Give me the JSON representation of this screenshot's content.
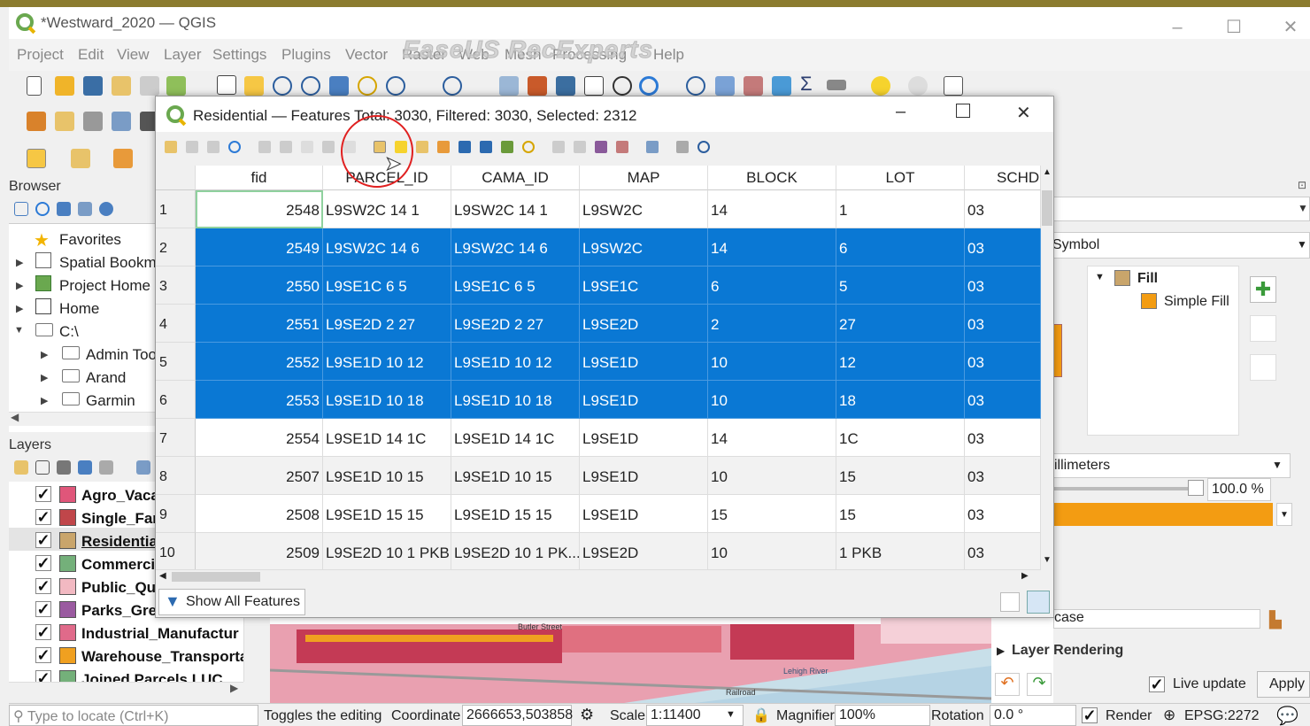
{
  "window": {
    "title": "*Westward_2020 — QGIS"
  },
  "menu": [
    "Project",
    "Edit",
    "View",
    "Layer",
    "Settings",
    "Plugins",
    "Vector",
    "Raster",
    "Web",
    "Mesh",
    "Processing",
    "Help"
  ],
  "watermark": "EaseUS RecExperts",
  "browser": {
    "title": "Browser",
    "items": [
      "Favorites",
      "Spatial Bookm",
      "Project Home",
      "Home",
      "C:\\",
      "Admin Too",
      "Arand",
      "Garmin"
    ]
  },
  "layers": {
    "title": "Layers",
    "items": [
      {
        "name": "Agro_Vaca",
        "color": "#e0567a"
      },
      {
        "name": "Single_Far",
        "color": "#c0464a"
      },
      {
        "name": "Residentia",
        "color": "#c9a56b"
      },
      {
        "name": "Commerci",
        "color": "#74b07a"
      },
      {
        "name": "Public_Qu",
        "color": "#f2b9c2"
      },
      {
        "name": "Parks_Gre",
        "color": "#9a5aa0"
      },
      {
        "name": "Industrial_Manufactur",
        "color": "#e06a8a"
      },
      {
        "name": "Warehouse_Transporta",
        "color": "#f0a020"
      },
      {
        "name": "Joined Parcels LUC",
        "color": "#74b07a"
      }
    ]
  },
  "dialog": {
    "title": "Residential — Features Total: 3030, Filtered: 3030, Selected: 2312",
    "show_all": "Show All Features",
    "columns": [
      "fid",
      "PARCEL_ID",
      "CAMA_ID",
      "MAP",
      "BLOCK",
      "LOT",
      "SCHD"
    ],
    "rows": [
      {
        "n": "1",
        "fid": "2548",
        "parcel": "L9SW2C 14 1",
        "cama": "L9SW2C 14 1",
        "map": "L9SW2C",
        "block": "14",
        "lot": "1",
        "schd": "03",
        "selected": false
      },
      {
        "n": "2",
        "fid": "2549",
        "parcel": "L9SW2C 14 6",
        "cama": "L9SW2C 14 6",
        "map": "L9SW2C",
        "block": "14",
        "lot": "6",
        "schd": "03",
        "selected": true
      },
      {
        "n": "3",
        "fid": "2550",
        "parcel": "L9SE1C 6 5",
        "cama": "L9SE1C 6 5",
        "map": "L9SE1C",
        "block": "6",
        "lot": "5",
        "schd": "03",
        "selected": true
      },
      {
        "n": "4",
        "fid": "2551",
        "parcel": "L9SE2D 2 27",
        "cama": "L9SE2D 2 27",
        "map": "L9SE2D",
        "block": "2",
        "lot": "27",
        "schd": "03",
        "selected": true
      },
      {
        "n": "5",
        "fid": "2552",
        "parcel": "L9SE1D 10 12",
        "cama": "L9SE1D 10 12",
        "map": "L9SE1D",
        "block": "10",
        "lot": "12",
        "schd": "03",
        "selected": true
      },
      {
        "n": "6",
        "fid": "2553",
        "parcel": "L9SE1D 10 18",
        "cama": "L9SE1D 10 18",
        "map": "L9SE1D",
        "block": "10",
        "lot": "18",
        "schd": "03",
        "selected": true
      },
      {
        "n": "7",
        "fid": "2554",
        "parcel": "L9SE1D 14 1C",
        "cama": "L9SE1D 14 1C",
        "map": "L9SE1D",
        "block": "14",
        "lot": "1C",
        "schd": "03",
        "selected": false
      },
      {
        "n": "8",
        "fid": "2507",
        "parcel": "L9SE1D 10 15",
        "cama": "L9SE1D 10 15",
        "map": "L9SE1D",
        "block": "10",
        "lot": "15",
        "schd": "03",
        "selected": false
      },
      {
        "n": "9",
        "fid": "2508",
        "parcel": "L9SE1D 15 15",
        "cama": "L9SE1D 15 15",
        "map": "L9SE1D",
        "block": "15",
        "lot": "15",
        "schd": "03",
        "selected": false
      },
      {
        "n": "10",
        "fid": "2509",
        "parcel": "L9SE2D 10 1 PKB",
        "cama": "L9SE2D 10 1 PK...",
        "map": "L9SE2D",
        "block": "10",
        "lot": "1 PKB",
        "schd": "03",
        "selected": false
      }
    ]
  },
  "style_panel": {
    "symbol_label": "Symbol",
    "fill": "Fill",
    "simple_fill": "Simple Fill",
    "unit": "illimeters",
    "opacity": "100.0 %",
    "style_preset": "Showcase",
    "layer_rendering": "Layer Rendering",
    "live_update": "Live update",
    "apply": "Apply",
    "fill_color": "#f39c12"
  },
  "statusbar": {
    "locate_placeholder": "Type to locate (Ctrl+K)",
    "message": "Toggles the editing",
    "coord_label": "Coordinate",
    "coord_value": "2666653,503858",
    "scale_label": "Scale",
    "scale_value": "1:11400",
    "magnifier_label": "Magnifier",
    "magnifier_value": "100%",
    "rotation_label": "Rotation",
    "rotation_value": "0.0 °",
    "render": "Render",
    "epsg": "EPSG:2272"
  },
  "map_labels": {
    "street": "Butler Street",
    "river": "Lehigh River",
    "rail": "Railroad"
  }
}
